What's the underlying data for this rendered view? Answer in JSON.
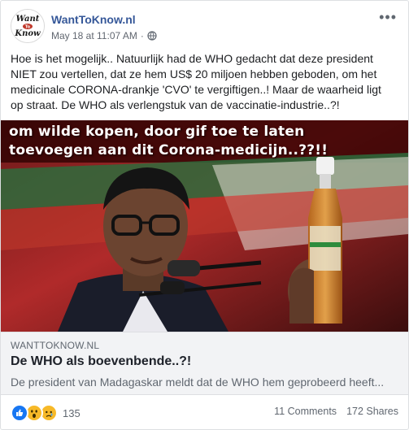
{
  "post": {
    "page_name": "WantToKnow.nl",
    "timestamp": "May 18 at 11:07 AM",
    "separator": "·",
    "avatar_logo": [
      "Want",
      "To",
      "Know"
    ],
    "text": "Hoe is het mogelijk.. Natuurlijk had de WHO gedacht dat deze president\nNIET zou vertellen, dat ze hem US$ 20 miljoen hebben geboden, om het\nmedicinale CORONA-drankje 'CVO' te vergiftigen..! Maar de waarheid ligt\nop straat. De WHO als verlengstuk van de vaccinatie-industrie..?!"
  },
  "media": {
    "overlay_line_1": "om wilde kopen, door gif toe te laten",
    "overlay_line_2": "toevoegen aan dit Corona-medicijn..??!!"
  },
  "link_preview": {
    "domain": "WANTTOKNOW.NL",
    "title": "De WHO als boevenbende..?!",
    "description": "De president van Madagaskar meldt dat de WHO hem geprobeerd heeft..."
  },
  "footer": {
    "reaction_icons": [
      "like-icon",
      "wow-icon",
      "sad-icon"
    ],
    "reaction_count": "135",
    "comments": "11 Comments",
    "shares": "172 Shares"
  },
  "colors": {
    "page_link": "#365899",
    "like": "#1877f2",
    "wow": "#f7b928",
    "link_bg": "#f2f3f5"
  }
}
